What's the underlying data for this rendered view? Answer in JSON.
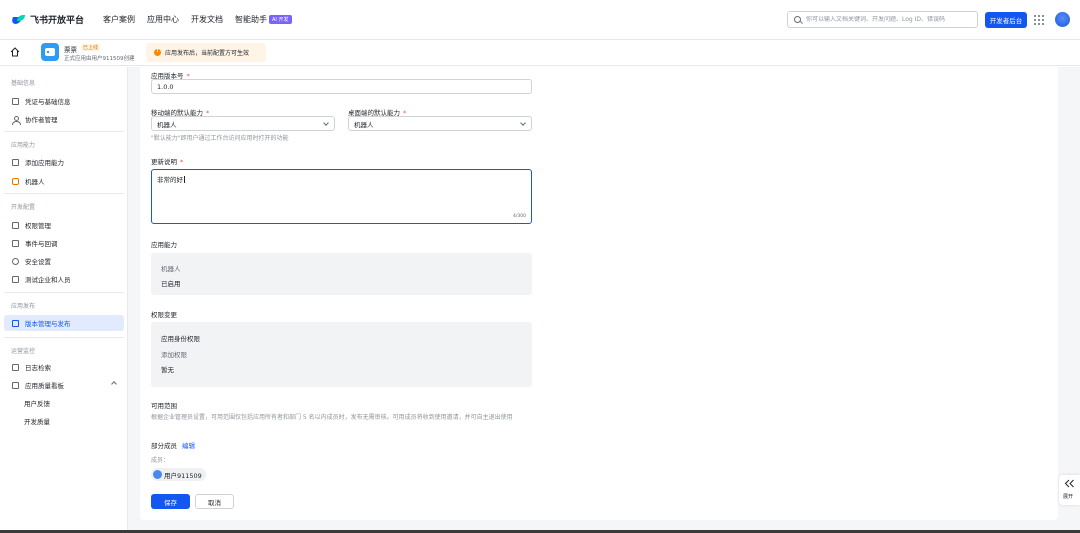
{
  "topnav": {
    "logo_text": "飞书开放平台",
    "links": [
      "客户案例",
      "应用中心",
      "开发文档",
      "智能助手"
    ],
    "ai_badge": "AI 开发",
    "search_placeholder": "你可以输入文档关键词、开发问题、Log ID、错误码",
    "dev_console_label": "开发者后台"
  },
  "appbar": {
    "app_name": "票票",
    "online_tag": "已上线",
    "app_desc": "正式应用由用户911509创建",
    "notice": "应用发布后，当前配置方可生效"
  },
  "sidebar": {
    "groups": [
      "基础信息",
      "应用能力",
      "开发配置",
      "应用发布",
      "运营监控"
    ],
    "items": [
      "凭证与基础信息",
      "协作者管理",
      "添加应用能力",
      "机器人",
      "权限管理",
      "事件与回调",
      "安全设置",
      "测试企业和人员",
      "版本管理与发布",
      "日志检索",
      "应用质量看板",
      "用户反馈",
      "开发质量"
    ]
  },
  "form": {
    "version_label": "应用版本号",
    "version_value": "1.0.0",
    "mobile_label": "移动端的默认能力",
    "mobile_value": "机器人",
    "desktop_label": "桌面端的默认能力",
    "desktop_value": "机器人",
    "default_hint": "\"默认能力\"即用户通过工作台访问应用时打开的功能",
    "notes_label": "更新说明",
    "notes_value": "非常的好",
    "notes_counter": "4/300",
    "capability_title": "应用能力",
    "capability_name": "机器人",
    "capability_status": "已启用",
    "permission_title": "权限变更",
    "permission_group": "应用身份权限",
    "permission_add": "添加权限",
    "permission_none": "暂无",
    "scope_title": "可用范围",
    "scope_desc": "根据企业管理员设置，可用范围仅包括应用所有者和部门 5 名以内成员时，发布无需审核。可用成员将收到使用邀请，并可自主退出使用",
    "scope_partial": "部分成员",
    "scope_edit": "编辑",
    "members_label": "成员：",
    "member_name": "用户911509",
    "save_label": "保存",
    "cancel_label": "取消"
  },
  "expand_label": "展开"
}
